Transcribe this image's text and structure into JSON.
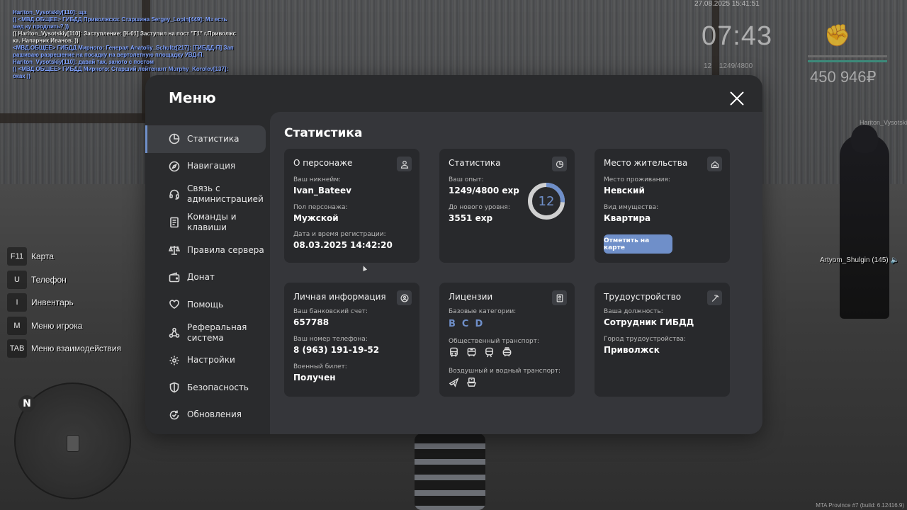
{
  "chat": [
    {
      "text": "Hariton_Vysotskiy[110]: ща",
      "color": "blue"
    },
    {
      "text": "(( <МВД.ОБЩЕЕ> ГИБДД Приволжска: Старшина Sergey_Lopin[449]: Мз есть мед ку продлить? ))",
      "color": "blue"
    },
    {
      "text": "(( Hariton_Vysotskiy[110]: Заступление: [К-01] Заступил на пост \"Г1\" г.Приволжс ка. Напарник Иванов. ))",
      "color": "white"
    },
    {
      "text": "<МВД.ОБЩЕЕ> ГИБДД Мирного: Генерал Anatoliy_Schultz[217]: [ГИБДД-П] Зап рашиваю разрешение на посадку на вертолетную площадку УВД-П.",
      "color": "blue"
    },
    {
      "text": "Hariton_Vysotskiy[110]: давай так, заного с постом",
      "color": "blue"
    },
    {
      "text": "(( <МВД.ОБЩЕЕ> ГИБДД Мирного: Старший лейтенант Murphy_Korolev[137]: окак ))",
      "color": "blue"
    }
  ],
  "hud": {
    "date": "27.08.2025 15:41:51",
    "time": "07:43",
    "level": "12",
    "exp": "1249/4800",
    "money": "450 946₽",
    "fist_icon": "fist-icon",
    "player_tag": "Hariton_Vysotskiy",
    "player_tag2": "Artyom_Shulgin (145) 🔈",
    "build": "MTA Province #7 (build: 6.12416.9)",
    "health_color": "#6c6c6c",
    "armor_color": "#3d8a7a"
  },
  "keybinds": [
    {
      "key": "F11",
      "label": "Карта"
    },
    {
      "key": "U",
      "label": "Телефон"
    },
    {
      "key": "I",
      "label": "Инвентарь"
    },
    {
      "key": "M",
      "label": "Меню игрока"
    },
    {
      "key": "TAB",
      "label": "Меню взаимодействия"
    }
  ],
  "radar": {
    "north": "N"
  },
  "menu": {
    "title": "Меню",
    "sidebar": [
      {
        "label": "Статистика",
        "icon": "pie-chart-icon",
        "active": true
      },
      {
        "label": "Навигация",
        "icon": "compass-icon"
      },
      {
        "label": "Связь с администрацией",
        "icon": "headset-icon"
      },
      {
        "label": "Команды и клавиши",
        "icon": "document-icon"
      },
      {
        "label": "Правила сервера",
        "icon": "scales-icon"
      },
      {
        "label": "Донат",
        "icon": "wallet-icon"
      },
      {
        "label": "Помощь",
        "icon": "heart-hands-icon"
      },
      {
        "label": "Реферальная система",
        "icon": "network-icon"
      },
      {
        "label": "Настройки",
        "icon": "gear-icon"
      },
      {
        "label": "Безопасность",
        "icon": "shield-icon"
      },
      {
        "label": "Обновления",
        "icon": "refresh-check-icon"
      }
    ],
    "content_title": "Статистика",
    "cards": {
      "character": {
        "title": "О персонаже",
        "icon": "user-icon",
        "nickname_label": "Ваш никнейм:",
        "nickname": "Ivan_Bateev",
        "gender_label": "Пол персонажа:",
        "gender": "Мужской",
        "reg_label": "Дата и время регистрации:",
        "reg": "08.03.2025 14:42:20"
      },
      "stats": {
        "title": "Статистика",
        "icon": "pie-chart-icon",
        "exp_label": "Ваш опыт:",
        "exp": "1249/4800 exp",
        "next_label": "До нового уровня:",
        "next": "3551 exp",
        "level": "12",
        "progress": 0.26,
        "accent": "#6f8fc9"
      },
      "residence": {
        "title": "Место жительства",
        "icon": "home-icon",
        "place_label": "Место проживания:",
        "place": "Невский",
        "property_label": "Вид имущества:",
        "property": "Квартира",
        "button": "Отметить на карте"
      },
      "personal": {
        "title": "Личная информация",
        "icon": "user-circle-icon",
        "bank_label": "Ваш банковский счет:",
        "bank": "657788",
        "phone_label": "Ваш номер телефона:",
        "phone": "8 (963) 191-19-52",
        "military_label": "Военный билет:",
        "military": "Получен"
      },
      "licenses": {
        "title": "Лицензии",
        "icon": "id-card-icon",
        "base_label": "Базовые категории:",
        "categories": [
          "B",
          "C",
          "D"
        ],
        "public_label": "Общественный транспорт:",
        "public_icons": [
          "bus-icon",
          "bus-front-icon",
          "train-icon",
          "trolley-icon"
        ],
        "air_label": "Воздушный и водный транспорт:",
        "air_icons": [
          "plane-icon",
          "ship-icon"
        ]
      },
      "job": {
        "title": "Трудоустройство",
        "icon": "pickaxe-icon",
        "position_label": "Ваша должность:",
        "position": "Сотрудник ГИБДД",
        "city_label": "Город трудоустройства:",
        "city": "Приволжск"
      }
    }
  }
}
